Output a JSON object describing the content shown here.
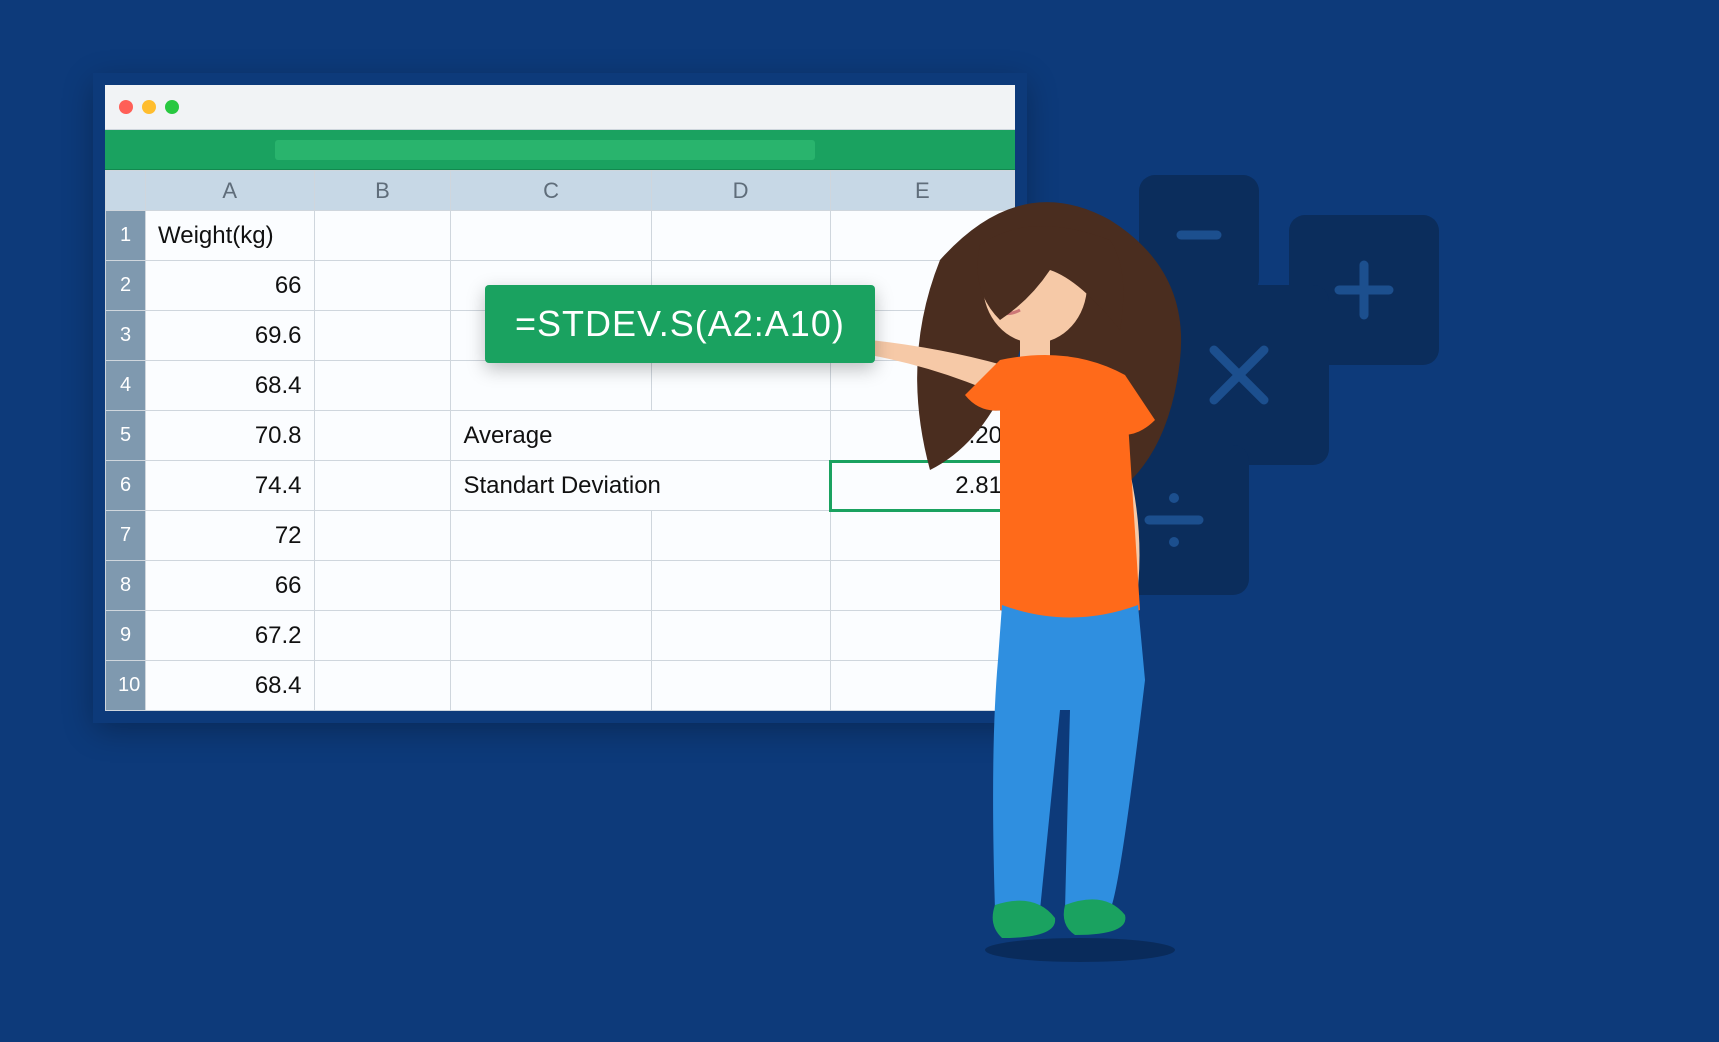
{
  "columns": [
    "A",
    "B",
    "C",
    "D",
    "E"
  ],
  "rows": [
    {
      "n": "1",
      "A": "Weight(kg)",
      "C": "",
      "D": "",
      "E": ""
    },
    {
      "n": "2",
      "A": "66"
    },
    {
      "n": "3",
      "A": "69.6"
    },
    {
      "n": "4",
      "A": "68.4"
    },
    {
      "n": "5",
      "A": "70.8",
      "C": "Average",
      "E": "69.20"
    },
    {
      "n": "6",
      "A": "74.4",
      "C": "Standart Deviation",
      "E": "2.81"
    },
    {
      "n": "7",
      "A": "72"
    },
    {
      "n": "8",
      "A": "66"
    },
    {
      "n": "9",
      "A": "67.2"
    },
    {
      "n": "10",
      "A": "68.4"
    }
  ],
  "formula": "=STDEV.S(A2:A10)",
  "selected_cell": "E6",
  "chart_data": {
    "type": "table",
    "title": "Weight(kg)",
    "values": [
      66,
      69.6,
      68.4,
      70.8,
      74.4,
      72,
      66,
      67.2,
      68.4
    ],
    "stats": {
      "Average": 69.2,
      "Standart Deviation": 2.81
    },
    "formula": "=STDEV.S(A2:A10)"
  }
}
